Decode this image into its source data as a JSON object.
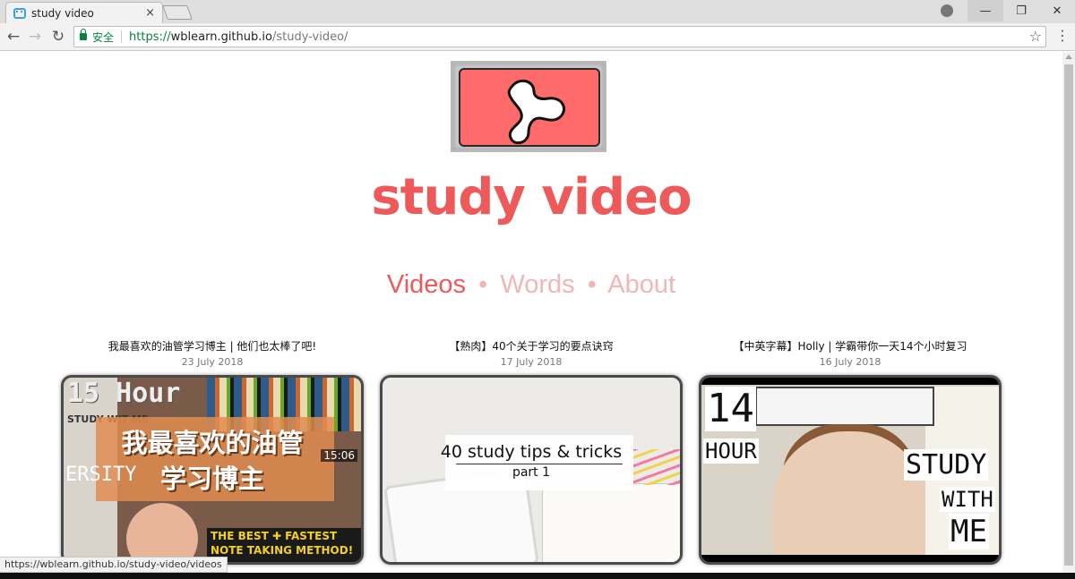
{
  "browser": {
    "tab_title": "study video",
    "tab_close": "×",
    "secure_label": "安全",
    "url_scheme": "https://",
    "url_host": "wblearn.github.io",
    "url_path": "/study-video/",
    "icons": [
      "back-icon",
      "forward-icon",
      "reload-icon",
      "lock-icon",
      "star-icon",
      "menu-icon",
      "profile-icon"
    ],
    "status_url": "https://wblearn.github.io/study-video/videos"
  },
  "site": {
    "title": "study video",
    "accent_color": "#ee5a5a",
    "muted_color": "#f2b6b6",
    "nav": {
      "videos": "Videos",
      "separator": "•",
      "words": "Words",
      "about": "About"
    }
  },
  "videos": [
    {
      "title": "我最喜欢的油管学习博主 | 他们也太棒了吧!",
      "date": "23 July 2018",
      "thumb": {
        "hour": "15 Hour",
        "side": "STUDY WIT ME",
        "line1": "我最喜欢的油管",
        "line2": "学习博主",
        "duration": "15:06",
        "vertical": "ERSITY",
        "banner1": "THE BEST ✚ FASTEST",
        "banner2": "NOTE TAKING METHOD!"
      }
    },
    {
      "title": "【熟肉】40个关于学习的要点诀窍",
      "date": "17 July 2018",
      "thumb": {
        "heading": "40 study tips & tricks",
        "sub": "part 1"
      }
    },
    {
      "title": "【中英字幕】Holly | 学霸带你一天14个小时复习",
      "date": "16 July 2018",
      "thumb": {
        "num": "14",
        "hour": "HOUR",
        "study": "STUDY",
        "with": "WITH",
        "me": "ME"
      }
    }
  ]
}
